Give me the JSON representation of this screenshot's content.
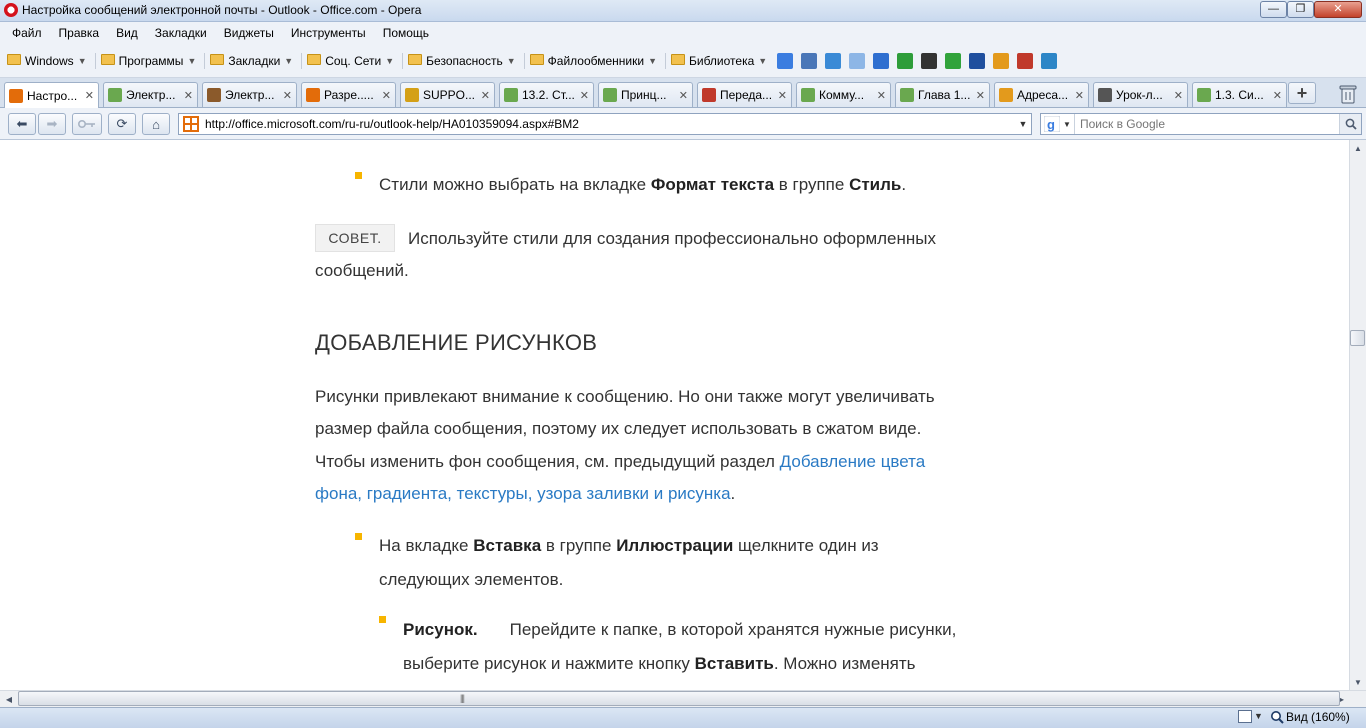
{
  "window": {
    "title": "Настройка сообщений электронной почты - Outlook - Office.com - Opera",
    "min_glyph": "—",
    "max_glyph": "❐",
    "close_glyph": "✕"
  },
  "menu": [
    "Файл",
    "Правка",
    "Вид",
    "Закладки",
    "Виджеты",
    "Инструменты",
    "Помощь"
  ],
  "bookmarks": {
    "folders": [
      "Windows",
      "Программы",
      "Закладки",
      "Соц. Сети",
      "Безопасность",
      "Файлообменники",
      "Библиотека"
    ],
    "icons": [
      {
        "name": "google-icon",
        "color": "#3b7de0"
      },
      {
        "name": "mail-icon",
        "color": "#4a77b8"
      },
      {
        "name": "translate-icon",
        "color": "#3a8ad6"
      },
      {
        "name": "arrow-icon",
        "color": "#8db6e6"
      },
      {
        "name": "word-icon",
        "color": "#2f6fd0"
      },
      {
        "name": "h-icon",
        "color": "#2e9d3a"
      },
      {
        "name": "bracket-icon",
        "color": "#333333"
      },
      {
        "name": "play-icon",
        "color": "#31a33b"
      },
      {
        "name": "next-icon",
        "color": "#1f4f9e"
      },
      {
        "name": "face-icon",
        "color": "#e39a1c"
      },
      {
        "name": "flag-icon",
        "color": "#c0392b"
      },
      {
        "name": "gear-flower-icon",
        "color": "#2d86c7"
      }
    ]
  },
  "tabs": [
    {
      "label": "Настро...",
      "icon": "office-icon",
      "color": "#e36c0a",
      "active": true
    },
    {
      "label": "Электр...",
      "icon": "doc-icon",
      "color": "#6aa84f",
      "active": false
    },
    {
      "label": "Электр...",
      "icon": "feather-icon",
      "color": "#8b5a2b",
      "active": false
    },
    {
      "label": "Разре.....",
      "icon": "office-icon",
      "color": "#e36c0a",
      "active": false
    },
    {
      "label": "SUPPO...",
      "icon": "warning-icon",
      "color": "#d4a017",
      "active": false
    },
    {
      "label": "13.2. Ст...",
      "icon": "doc-icon",
      "color": "#6aa84f",
      "active": false
    },
    {
      "label": "Принц...",
      "icon": "doc-icon",
      "color": "#6aa84f",
      "active": false
    },
    {
      "label": "Переда...",
      "icon": "pen-icon",
      "color": "#c0392b",
      "active": false
    },
    {
      "label": "Комму...",
      "icon": "doc-icon",
      "color": "#6aa84f",
      "active": false
    },
    {
      "label": "Глава 1...",
      "icon": "doc-icon",
      "color": "#6aa84f",
      "active": false
    },
    {
      "label": "Адреса...",
      "icon": "smile-icon",
      "color": "#e39a1c",
      "active": false
    },
    {
      "label": "Урок-л...",
      "icon": "dots-icon",
      "color": "#555555",
      "active": false
    },
    {
      "label": "1.3. Си...",
      "icon": "doc-icon",
      "color": "#6aa84f",
      "active": false
    }
  ],
  "tab_close_glyph": "✕",
  "newtab_glyph": "+",
  "nav": {
    "back_glyph": "⬅",
    "forward_glyph": "➡",
    "reload_glyph": "⟳",
    "home_glyph": "⌂"
  },
  "address": {
    "url": "http://office.microsoft.com/ru-ru/outlook-help/HA010359094.aspx#BM2",
    "drop_glyph": "▼"
  },
  "search": {
    "placeholder": "Поиск в Google",
    "engine_drop": "▼"
  },
  "content": {
    "bullet1": {
      "prefix": "Стили можно выбрать на вкладке ",
      "bold1": "Формат текста",
      "middle": " в группе ",
      "bold2": "Стиль",
      "suffix": "."
    },
    "tip": {
      "label": "СОВЕТ.",
      "line1": "Используйте стили для создания профессионально оформленных",
      "line2": "сообщений."
    },
    "heading": "ДОБАВЛЕНИЕ РИСУНКОВ",
    "para": {
      "line1": "Рисунки привлекают внимание к сообщению. Но они также могут увеличивать",
      "line2": "размер файла сообщения, поэтому их следует использовать в сжатом виде.",
      "line3_prefix": "Чтобы изменить фон сообщения, см. предыдущий раздел ",
      "link1": "Добавление цвета",
      "link2": "фона, градиента, текстуры, узора заливки и рисунка",
      "line4_suffix": "."
    },
    "bullet2": {
      "prefix": "На вкладке ",
      "bold1": "Вставка",
      "middle": " в группе ",
      "bold2": "Иллюстрации",
      "suffix": " щелкните один из",
      "line2": "следующих элементов."
    },
    "bullet3": {
      "bold1": "Рисунок.",
      "text1": "Перейдите к папке, в которой хранятся нужные рисунки,",
      "prefix2": "выберите рисунок и нажмите кнопку ",
      "bold2": "Вставить",
      "suffix2": ". Можно изменять"
    }
  },
  "scroll": {
    "up": "▲",
    "down": "▼",
    "left": "◀",
    "right": "▶",
    "grip": "|||"
  },
  "status": {
    "zoom_label": "Вид (160%)",
    "drop_glyph": "▼"
  }
}
